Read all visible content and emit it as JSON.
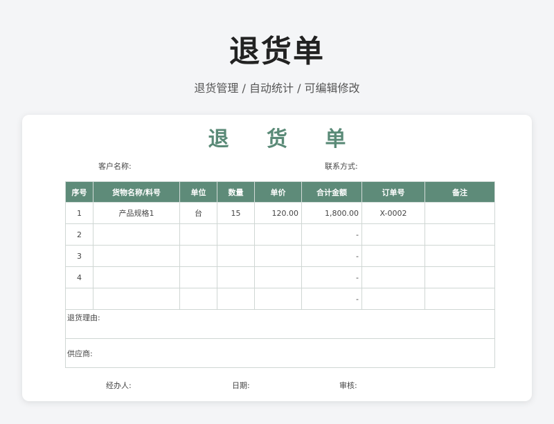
{
  "header": {
    "title": "退货单",
    "subtitle": "退货管理 / 自动统计 /  可编辑修改"
  },
  "document": {
    "title": "退 货 单",
    "customer_label": "客户名称:",
    "contact_label": "联系方式:",
    "columns": [
      "序号",
      "货物名称/料号",
      "单位",
      "数量",
      "单价",
      "合计金额",
      "订单号",
      "备注"
    ],
    "rows": [
      {
        "index": "1",
        "name": "产品规格1",
        "unit": "台",
        "qty": "15",
        "price": "120.00",
        "total": "1,800.00",
        "order": "X-0002",
        "note": ""
      },
      {
        "index": "2",
        "name": "",
        "unit": "",
        "qty": "",
        "price": "",
        "total": "-",
        "order": "",
        "note": ""
      },
      {
        "index": "3",
        "name": "",
        "unit": "",
        "qty": "",
        "price": "",
        "total": "-",
        "order": "",
        "note": ""
      },
      {
        "index": "4",
        "name": "",
        "unit": "",
        "qty": "",
        "price": "",
        "total": "-",
        "order": "",
        "note": ""
      },
      {
        "index": "",
        "name": "",
        "unit": "",
        "qty": "",
        "price": "",
        "total": "-",
        "order": "",
        "note": ""
      }
    ],
    "reason_label": "退货理由:",
    "supplier_label": "供应商:",
    "handler_label": "经办人:",
    "date_label": "日期:",
    "review_label": "审核:"
  },
  "colors": {
    "accent": "#5e8b79",
    "title_green": "#5a8a77"
  }
}
